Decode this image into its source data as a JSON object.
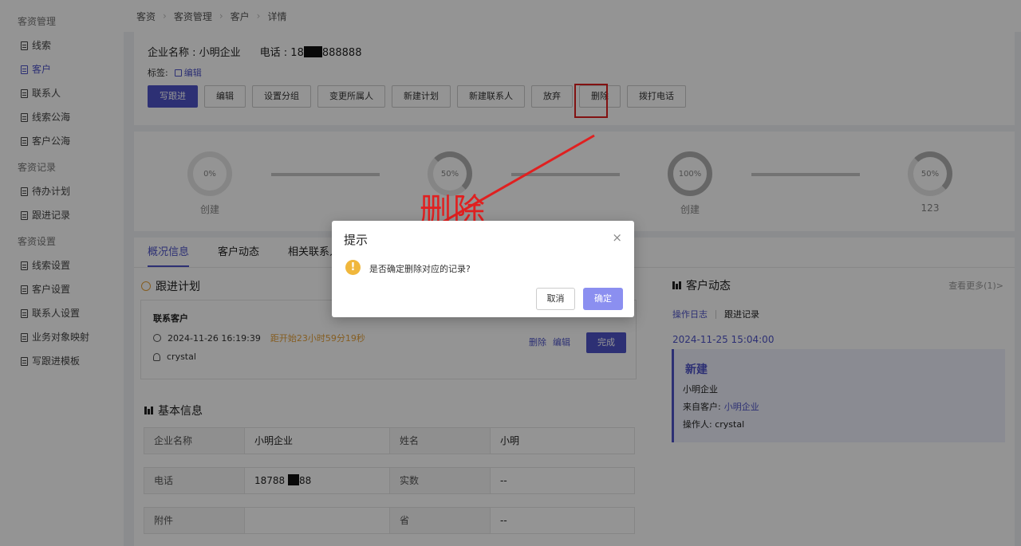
{
  "sidebar": {
    "groups": [
      {
        "title": "客资管理",
        "items": [
          "线索",
          "客户",
          "联系人",
          "线索公海",
          "客户公海"
        ]
      },
      {
        "title": "客资记录",
        "items": [
          "待办计划",
          "跟进记录"
        ]
      },
      {
        "title": "客资设置",
        "items": [
          "线索设置",
          "客户设置",
          "联系人设置",
          "业务对象映射",
          "写跟进模板"
        ]
      }
    ]
  },
  "breadcrumb": [
    "客资",
    "客资管理",
    "客户",
    "详情"
  ],
  "header": {
    "company_label": "企业名称 : 小明企业",
    "phone_prefix": "电话 : 18",
    "phone_suffix": "888888",
    "tag_label": "标签:",
    "tag_edit": "编辑",
    "buttons": [
      "写跟进",
      "编辑",
      "设置分组",
      "变更所属人",
      "新建计划",
      "新建联系人",
      "放弃",
      "删除",
      "拨打电话"
    ]
  },
  "progress": {
    "stages": [
      {
        "percent": "0%",
        "label": "创建"
      },
      {
        "percent": "50%",
        "label": ""
      },
      {
        "percent": "100%",
        "label": "创建"
      },
      {
        "percent": "50%",
        "label": "123"
      }
    ]
  },
  "tabs": [
    "概况信息",
    "客户动态",
    "相关联系人"
  ],
  "plan": {
    "section_title": "跟进计划",
    "title": "联系客户",
    "time": "2024-11-26 16:19:39",
    "countdown": "距开始23小时59分19秒",
    "user": "crystal",
    "delete": "删除",
    "edit": "编辑",
    "done": "完成"
  },
  "basic_info": {
    "section_title": "基本信息",
    "rows": [
      [
        "企业名称",
        "小明企业",
        "姓名",
        "小明"
      ],
      [
        "电话",
        "18788",
        "实数",
        "--"
      ],
      [
        "附件",
        "",
        "省",
        "--"
      ]
    ],
    "phone_suffix": "88"
  },
  "activity": {
    "title": "客户动态",
    "more": "查看更多(1)>",
    "tab_log": "操作日志",
    "tab_follow": "跟进记录",
    "date": "2024-11-25 15:04:00",
    "card_title": "新建",
    "company": "小明企业",
    "from_label": "来自客户:",
    "from_value": "小明企业",
    "operator": "操作人: crystal"
  },
  "annotation": "删除",
  "dialog": {
    "title": "提示",
    "message": "是否确定删除对应的记录?",
    "cancel": "取消",
    "confirm": "确定",
    "close_icon": "×"
  }
}
